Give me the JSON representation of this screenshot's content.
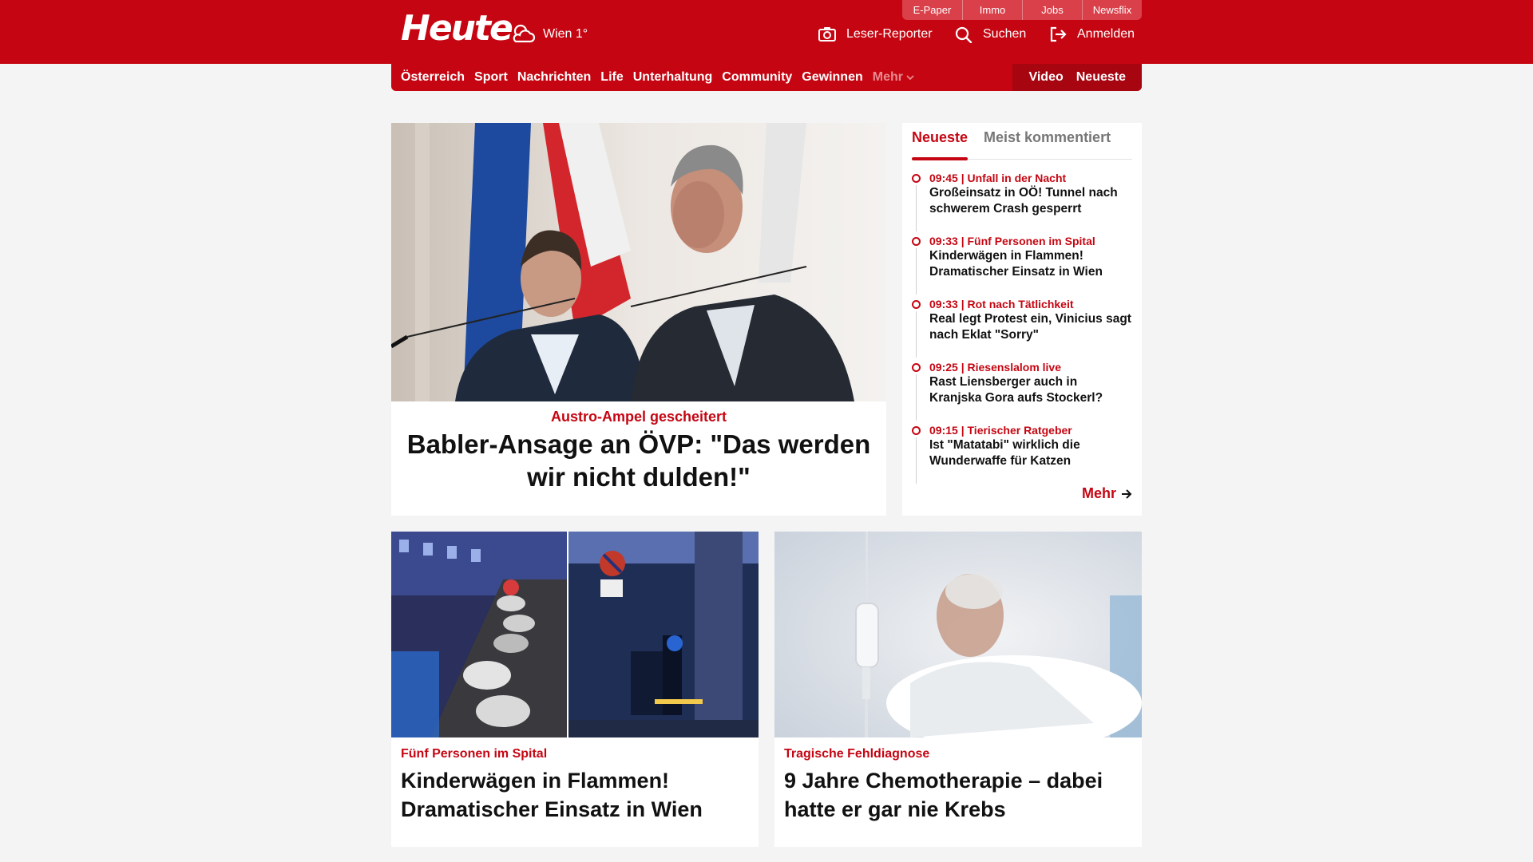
{
  "brand": {
    "name": "Heute",
    "weather_city": "Wien",
    "weather_temp": "1°"
  },
  "service_links": [
    "E-Paper",
    "Immo",
    "Jobs",
    "Newsflix"
  ],
  "header_actions": {
    "reporter": "Leser-Reporter",
    "search": "Suchen",
    "login": "Anmelden"
  },
  "nav": {
    "items": [
      "Österreich",
      "Sport",
      "Nachrichten",
      "Life",
      "Unterhaltung",
      "Community",
      "Gewinnen"
    ],
    "more": "Mehr",
    "right": [
      "Video",
      "Neueste"
    ]
  },
  "hero": {
    "kicker": "Austro-Ampel gescheitert",
    "title": "Babler-Ansage an ÖVP: \"Das werden wir nicht dulden!\""
  },
  "sidebar": {
    "tabs": [
      "Neueste",
      "Meist kommentiert"
    ],
    "items": [
      {
        "meta": "09:45 | Unfall in der Nacht",
        "title": "Großeinsatz in OÖ! Tunnel nach schwerem Crash gesperrt"
      },
      {
        "meta": "09:33 | Fünf Personen im Spital",
        "title": "Kinderwägen in Flammen! Dramatischer Einsatz in Wien"
      },
      {
        "meta": "09:33 | Rot nach Tätlichkeit",
        "title": "Real legt Protest ein, Vinicius sagt nach Eklat \"Sorry\""
      },
      {
        "meta": "09:25 | Riesenslalom live",
        "title": "Rast Liensberger auch in Kranjska Gora aufs Stockerl?"
      },
      {
        "meta": "09:15 | Tierischer Ratgeber",
        "title": "Ist \"Matatabi\" wirklich die Wunderwaffe für Katzen"
      }
    ],
    "more": "Mehr"
  },
  "cards": [
    {
      "kicker": "Fünf Personen im Spital",
      "title": "Kinderwägen in Flammen! Dramatischer Einsatz in Wien"
    },
    {
      "kicker": "Tragische Fehldiagnose",
      "title": "9 Jahre Chemotherapie – dabei hatte er gar nie Krebs"
    }
  ],
  "colors": {
    "brand_red": "#c50612",
    "dark_red": "#a7050f",
    "background": "#f4f4f4"
  }
}
